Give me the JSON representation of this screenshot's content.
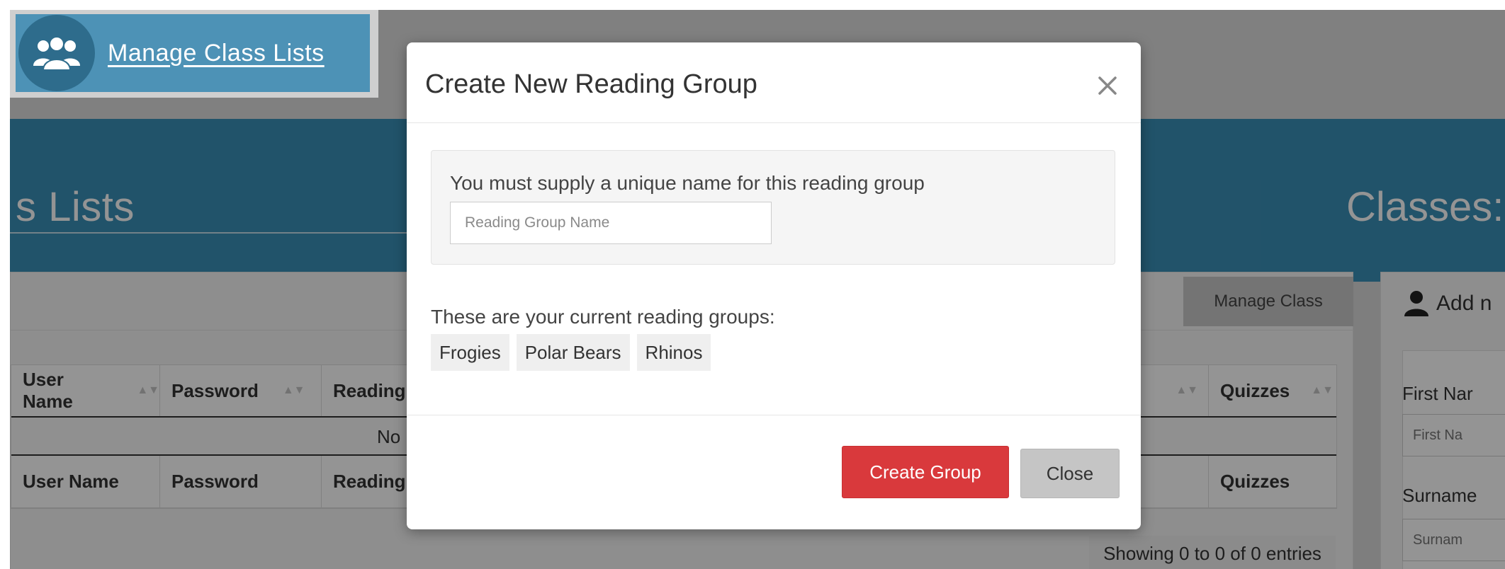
{
  "header": {
    "badge_title": "Manage Class Lists",
    "badge_icon": "users-icon"
  },
  "background": {
    "hero_left_title": "s Lists",
    "hero_right_title": "Classes:",
    "manage_class_button": "Manage Class",
    "table": {
      "columns": [
        "User Name",
        "Password",
        "Reading",
        "",
        "Quizzes"
      ],
      "empty_text": "No",
      "entries_info": "Showing 0 to 0 of 0 entries"
    },
    "add_panel": {
      "title": "Add n",
      "first_name_label": "First Nar",
      "first_name_placeholder": "First Na",
      "surname_label": "Surname",
      "surname_placeholder": "Surnam"
    }
  },
  "modal": {
    "title": "Create New Reading Group",
    "close_icon": "close-icon",
    "instruction": "You must supply a unique name for this reading group",
    "name_placeholder": "Reading Group Name",
    "name_value": "",
    "current_groups_label": "These are your current reading groups:",
    "groups": [
      "Frogies",
      "Polar Bears",
      "Rhinos"
    ],
    "create_button": "Create Group",
    "close_button": "Close"
  },
  "colors": {
    "hero_blue": "#3a8fb7",
    "badge_blue": "#4d92b6",
    "create_red": "#d9393c"
  }
}
